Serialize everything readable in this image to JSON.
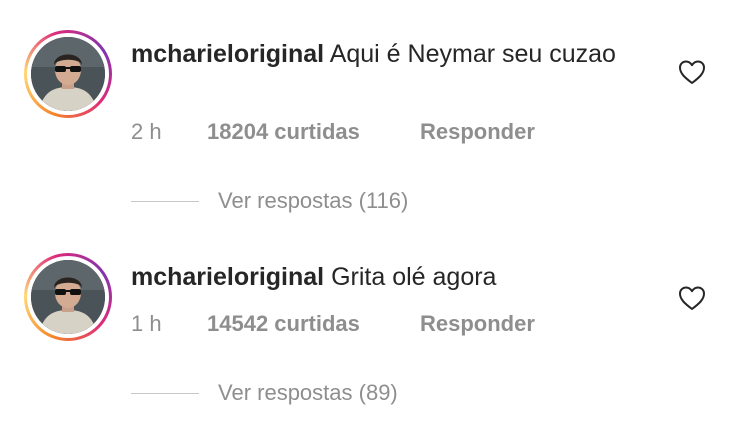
{
  "comments": [
    {
      "username": "mcharieloriginal",
      "text": "Aqui é Neymar seu cuzao",
      "time": "2 h",
      "likes": "18204 curtidas",
      "reply_label": "Responder",
      "view_replies": "Ver respostas (116)",
      "avatar_icon": "profile-photo",
      "like_icon": "heart-outline-icon"
    },
    {
      "username": "mcharieloriginal",
      "text": "Grita olé agora",
      "time": "1 h",
      "likes": "14542 curtidas",
      "reply_label": "Responder",
      "view_replies": "Ver respostas (89)",
      "avatar_icon": "profile-photo",
      "like_icon": "heart-outline-icon"
    }
  ],
  "colors": {
    "text": "#262626",
    "secondary": "#8e8e8e",
    "story_ring": [
      "#f58529",
      "#feda77",
      "#dd2a7b",
      "#8134af"
    ]
  }
}
